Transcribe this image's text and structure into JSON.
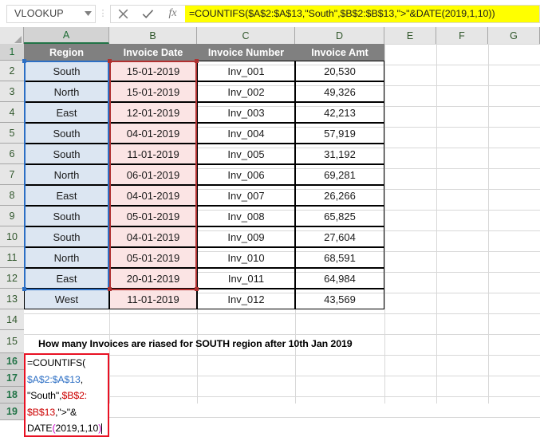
{
  "formula_bar": {
    "name_box_value": "VLOOKUP",
    "name_box_caret_icon": "chevron-down-icon",
    "cancel_icon": "close-icon",
    "confirm_icon": "check-icon",
    "insert_function_icon": "fx-icon",
    "insert_function_label": "fx",
    "formula_text": "=COUNTIFS($A$2:$A$13,\"South\",$B$2:$B$13,\">\"&DATE(2019,1,10))",
    "highlight_color": "#ffff00"
  },
  "sheet": {
    "column_headers": [
      "A",
      "B",
      "C",
      "D",
      "E",
      "F",
      "G"
    ],
    "active_column": "A",
    "row_headers": [
      "1",
      "2",
      "3",
      "4",
      "5",
      "6",
      "7",
      "8",
      "9",
      "10",
      "11",
      "12",
      "13",
      "14",
      "15",
      "16",
      "17",
      "18",
      "19"
    ],
    "table_headers": [
      "Region",
      "Invoice Date",
      "Invoice Number",
      "Invoice Amt"
    ],
    "rows": [
      {
        "row": "2",
        "region": "South",
        "date": "15-01-2019",
        "invoice": "Inv_001",
        "amount": "20,530"
      },
      {
        "row": "3",
        "region": "North",
        "date": "15-01-2019",
        "invoice": "Inv_002",
        "amount": "49,326"
      },
      {
        "row": "4",
        "region": "East",
        "date": "12-01-2019",
        "invoice": "Inv_003",
        "amount": "42,213"
      },
      {
        "row": "5",
        "region": "South",
        "date": "04-01-2019",
        "invoice": "Inv_004",
        "amount": "57,919"
      },
      {
        "row": "6",
        "region": "South",
        "date": "11-01-2019",
        "invoice": "Inv_005",
        "amount": "31,192"
      },
      {
        "row": "7",
        "region": "North",
        "date": "06-01-2019",
        "invoice": "Inv_006",
        "amount": "69,281"
      },
      {
        "row": "8",
        "region": "East",
        "date": "04-01-2019",
        "invoice": "Inv_007",
        "amount": "26,266"
      },
      {
        "row": "9",
        "region": "South",
        "date": "05-01-2019",
        "invoice": "Inv_008",
        "amount": "65,825"
      },
      {
        "row": "10",
        "region": "South",
        "date": "04-01-2019",
        "invoice": "Inv_009",
        "amount": "27,604"
      },
      {
        "row": "11",
        "region": "North",
        "date": "05-01-2019",
        "invoice": "Inv_010",
        "amount": "68,591"
      },
      {
        "row": "12",
        "region": "East",
        "date": "20-01-2019",
        "invoice": "Inv_011",
        "amount": "64,984"
      },
      {
        "row": "13",
        "region": "West",
        "date": "11-01-2019",
        "invoice": "Inv_012",
        "amount": "43,569"
      }
    ],
    "question_text": "How many Invoices are riased for SOUTH region after 10th Jan 2019",
    "editing_cell": "A16",
    "editing_lines": [
      [
        {
          "t": "=COUNTIFS(",
          "c": "black"
        }
      ],
      [
        {
          "t": "$A$2:$A$13",
          "c": "blue"
        },
        {
          "t": ",",
          "c": "black"
        }
      ],
      [
        {
          "t": "\"South\",",
          "c": "black"
        },
        {
          "t": "$B$2:",
          "c": "red"
        }
      ],
      [
        {
          "t": "$B$13",
          "c": "red"
        },
        {
          "t": ",\">\"&",
          "c": "black"
        }
      ],
      [
        {
          "t": "DATE",
          "c": "black"
        },
        {
          "t": "(",
          "c": "magenta"
        },
        {
          "t": "2019,1,10",
          "c": "black"
        },
        {
          "t": ")",
          "c": "magenta"
        }
      ]
    ],
    "selection_ranges": [
      {
        "range": "$A$2:$A$13",
        "color": "#2d6fc4"
      },
      {
        "range": "$B$2:$B$13",
        "color": "#b03030"
      }
    ],
    "fill_colors": {
      "column_a": "#dce6f2",
      "column_b": "#fbe4e4",
      "header": "#808080"
    }
  }
}
